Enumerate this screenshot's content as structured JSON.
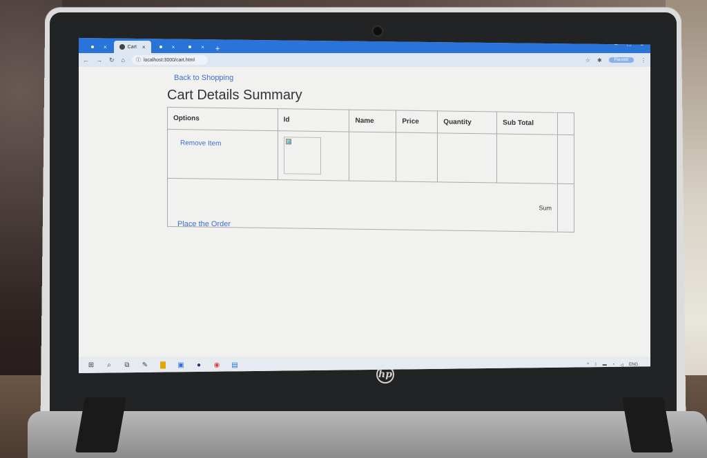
{
  "browser": {
    "tabs": [
      {
        "label": "",
        "active": false
      },
      {
        "label": "Cart",
        "active": true
      },
      {
        "label": "",
        "active": false
      },
      {
        "label": "",
        "active": false
      }
    ],
    "new_tab": "+",
    "address": "localhost:3000/cart.html",
    "profile_status": "Paused"
  },
  "page": {
    "back_link": "Back to Shopping",
    "title": "Cart Details Summary",
    "table": {
      "headers": [
        "Options",
        "Id",
        "Name",
        "Price",
        "Quantity",
        "Sub Total",
        ""
      ],
      "row": {
        "options_link": "Remove Item"
      },
      "footer_sum": "Sum"
    },
    "place_order": "Place the Order"
  },
  "device": {
    "brand": "hp"
  },
  "taskbar": {
    "lang": "ENG"
  }
}
